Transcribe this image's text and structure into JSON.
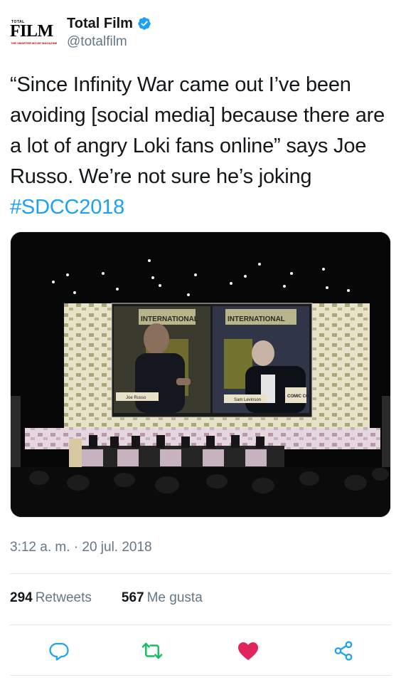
{
  "account": {
    "logo": {
      "top_text": "TOTAL",
      "main_text": "FILM",
      "tagline": "THE SMARTER MOVIE MAGAZINE"
    },
    "display_name": "Total Film",
    "verified": true,
    "handle": "@totalfilm"
  },
  "tweet": {
    "text_before_hashtag": "“Since Infinity War came out I’ve been avoiding [social media] because there are a lot of angry Loki fans online” says Joe Russo. We’re not sure he’s joking ",
    "hashtag": "#SDCC2018",
    "media": {
      "description": "Photo of Comic-Con panel stage with big screen",
      "screen_texts": [
        "INTERNATIONAL",
        "INTERNATIONAL",
        "Joe Russo",
        "Sam Levinson",
        "COMIC CON"
      ]
    },
    "timestamp": "3:12 a. m. · 20 jul. 2018"
  },
  "stats": {
    "retweets_count": "294",
    "retweets_label": "Retweets",
    "likes_count": "567",
    "likes_label": "Me gusta"
  },
  "actions": {
    "reply_icon": "reply-icon",
    "retweet_icon": "retweet-icon",
    "like_icon": "heart-icon",
    "share_icon": "share-icon"
  },
  "colors": {
    "text": "#14171a",
    "secondary": "#657786",
    "link": "#1da1f2",
    "retweet": "#17bf63",
    "like": "#e0245e",
    "divider": "#e1e8ed"
  }
}
